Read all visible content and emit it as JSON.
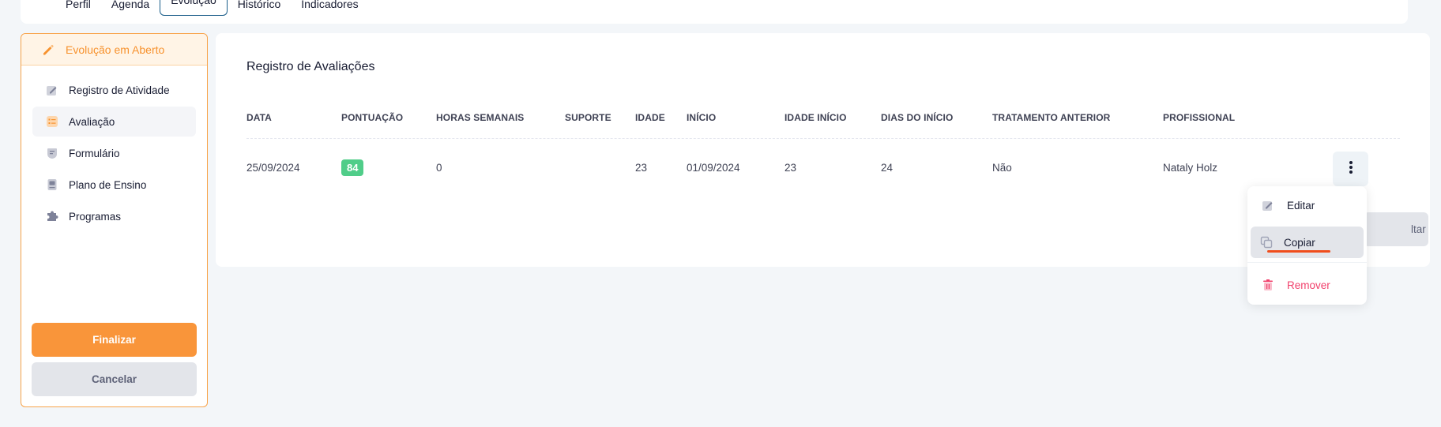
{
  "tabs": [
    "Perfil",
    "Agenda",
    "Evolução",
    "Histórico",
    "Indicadores"
  ],
  "active_tab": "Evolução",
  "sidebar": {
    "header": "Evolução em Aberto",
    "items": [
      {
        "label": "Registro de Atividade",
        "icon": "edit-icon"
      },
      {
        "label": "Avaliação",
        "icon": "checklist-icon"
      },
      {
        "label": "Formulário",
        "icon": "form-icon"
      },
      {
        "label": "Plano de Ensino",
        "icon": "book-icon"
      },
      {
        "label": "Programas",
        "icon": "puzzle-icon"
      }
    ],
    "finalize": "Finalizar",
    "cancel": "Cancelar"
  },
  "card": {
    "title": "Registro de Avaliações",
    "columns": [
      "DATA",
      "PONTUAÇÃO",
      "HORAS SEMANAIS",
      "SUPORTE",
      "IDADE",
      "INÍCIO",
      "IDADE INÍCIO",
      "DIAS DO INÍCIO",
      "TRATAMENTO ANTERIOR",
      "PROFISSIONAL"
    ],
    "row": {
      "data": "25/09/2024",
      "pontuacao": "84",
      "horas_semanais": "0",
      "suporte": "",
      "idade": "23",
      "inicio": "01/09/2024",
      "idade_inicio": "23",
      "dias_do_inicio": "24",
      "tratamento_anterior": "Não",
      "profissional": "Nataly Holz"
    },
    "partial_button": "ltar"
  },
  "menu": {
    "items": [
      {
        "label": "Editar",
        "icon": "pencil-icon"
      },
      {
        "label": "Copiar",
        "icon": "copy-icon"
      },
      {
        "label": "Remover",
        "icon": "trash-icon"
      }
    ]
  },
  "colors": {
    "accent": "#f9953a",
    "score_badge": "#50cd89",
    "danger": "#f1416c"
  }
}
